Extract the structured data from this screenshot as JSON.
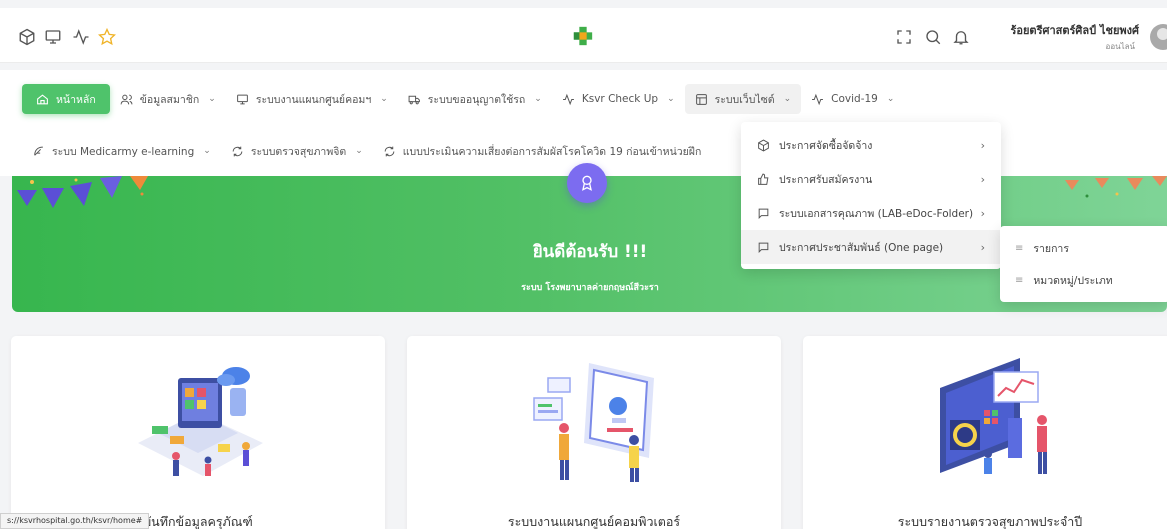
{
  "header": {
    "user_name": "ร้อยตรีศาสตร์ศิลป์ ไชยพงศ์",
    "user_status": "ออนไลน์",
    "icons": [
      "box-icon",
      "monitor-icon",
      "activity-icon",
      "star-icon",
      "logo-icon",
      "fullscreen-icon",
      "search-icon",
      "bell-icon"
    ]
  },
  "nav": {
    "row1": [
      {
        "label": "หน้าหลัก",
        "icon": "home-icon"
      },
      {
        "label": "ข้อมูลสมาชิก",
        "icon": "users-icon"
      },
      {
        "label": "ระบบงานแผนกศูนย์คอมฯ",
        "icon": "monitor-icon"
      },
      {
        "label": "ระบบขออนุญาตใช้รถ",
        "icon": "truck-icon"
      },
      {
        "label": "Ksvr Check Up",
        "icon": "activity-icon"
      },
      {
        "label": "ระบบเว็บไซต์",
        "icon": "layout-icon"
      },
      {
        "label": "Covid-19",
        "icon": "activity-icon"
      }
    ],
    "row2": [
      {
        "label": "ระบบ Medicarmy e-learning",
        "icon": "feather-icon"
      },
      {
        "label": "ระบบตรวจสุขภาพจิต",
        "icon": "refresh-icon"
      },
      {
        "label": "แบบประเมินความเสี่ยงต่อการสัมผัสโรคโควิด 19 ก่อนเข้าหน่วยฝึก",
        "icon": "refresh-icon"
      }
    ]
  },
  "dropdown": {
    "items": [
      {
        "label": "ประกาศจัดซื้อจัดจ้าง",
        "icon": "box-icon"
      },
      {
        "label": "ประกาศรับสมัครงาน",
        "icon": "thumbs-up-icon"
      },
      {
        "label": "ระบบเอกสารคุณภาพ (LAB-eDoc-Folder)",
        "icon": "message-square-icon"
      },
      {
        "label": "ประกาศประชาสัมพันธ์ (One page)",
        "icon": "message-square-icon"
      }
    ],
    "submenu": [
      "รายการ",
      "หมวดหมู่/ประเภท"
    ]
  },
  "banner": {
    "welcome": "ยินดีต้อนรับ !!!",
    "subtitle": "ระบบ โรงพยาบาลค่ายกฤษณ์สีวะรา"
  },
  "cards": [
    {
      "title": "บันทึกข้อมูลครุภัณฑ์"
    },
    {
      "title": "ระบบงานแผนกศูนย์คอมพิวเตอร์"
    },
    {
      "title": "ระบบรายงานตรวจสุขภาพประจำปี"
    }
  ],
  "statusbar": {
    "url": "s://ksvrhospital.go.th/ksvr/home#"
  },
  "colors": {
    "accent": "#4fc36b",
    "banner": "#44bb5a",
    "award": "#7c6cf0"
  }
}
